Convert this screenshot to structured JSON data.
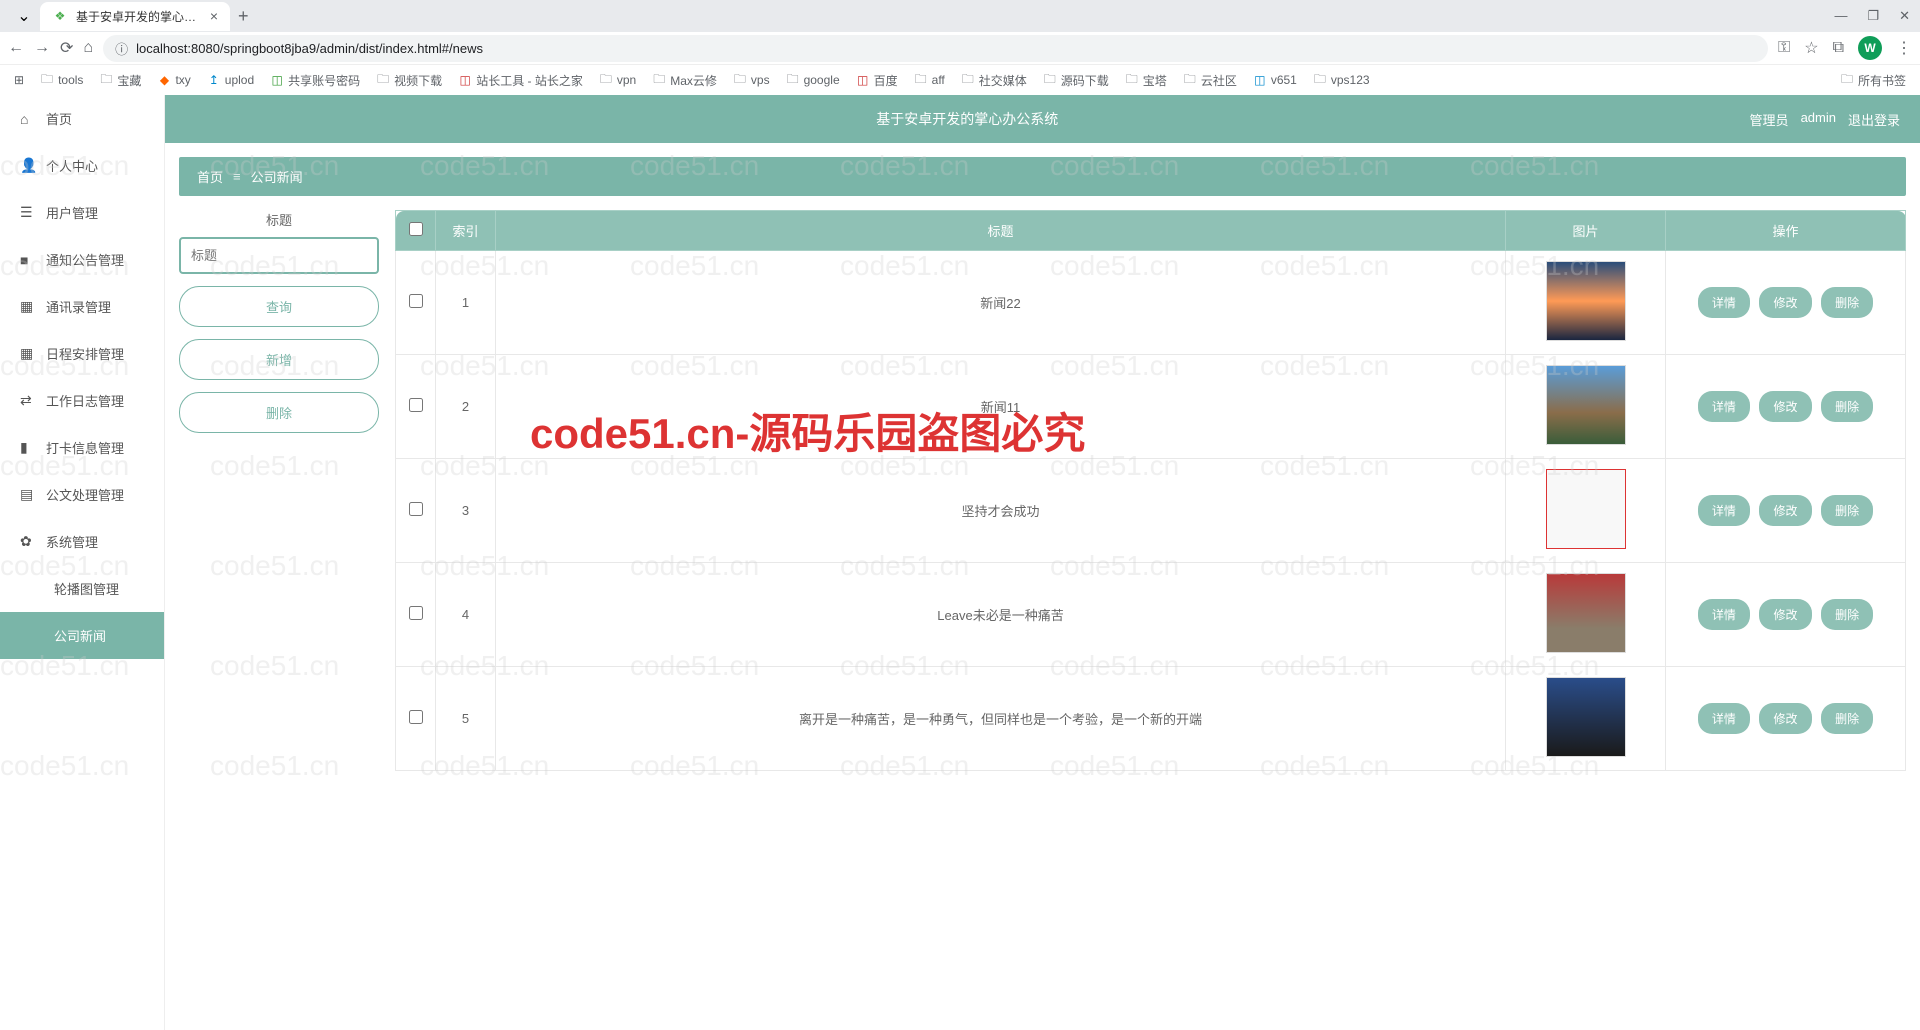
{
  "browser": {
    "tab_title": "基于安卓开发的掌心办公系统",
    "url": "localhost:8080/springboot8jba9/admin/dist/index.html#/news",
    "avatar_letter": "W",
    "bookmarks": [
      "tools",
      "宝藏",
      "txy",
      "uplod",
      "共享账号密码",
      "视频下载",
      "站长工具 - 站长之家",
      "vpn",
      "Max云修",
      "vps",
      "google",
      "百度",
      "aff",
      "社交媒体",
      "源码下载",
      "宝塔",
      "云社区",
      "v651",
      "vps123",
      "所有书签"
    ]
  },
  "header": {
    "title": "基于安卓开发的掌心办公系统",
    "role": "管理员",
    "user": "admin",
    "logout": "退出登录"
  },
  "sidebar": {
    "items": [
      {
        "icon": "⌂",
        "label": "首页"
      },
      {
        "icon": "👤",
        "label": "个人中心"
      },
      {
        "icon": "☰",
        "label": "用户管理"
      },
      {
        "icon": "■",
        "label": "通知公告管理"
      },
      {
        "icon": "▦",
        "label": "通讯录管理"
      },
      {
        "icon": "▦",
        "label": "日程安排管理"
      },
      {
        "icon": "⇄",
        "label": "工作日志管理"
      },
      {
        "icon": "▮",
        "label": "打卡信息管理"
      },
      {
        "icon": "▤",
        "label": "公文处理管理"
      },
      {
        "icon": "✿",
        "label": "系统管理"
      }
    ],
    "subs": [
      {
        "label": "轮播图管理"
      },
      {
        "label": "公司新闻"
      }
    ]
  },
  "breadcrumb": {
    "home": "首页",
    "sep": "≡",
    "current": "公司新闻"
  },
  "search": {
    "label": "标题",
    "placeholder": "标题",
    "query": "查询",
    "add": "新增",
    "delete": "删除"
  },
  "table": {
    "headers": {
      "index": "索引",
      "title": "标题",
      "image": "图片",
      "ops": "操作"
    },
    "btns": {
      "detail": "详情",
      "edit": "修改",
      "del": "删除"
    },
    "rows": [
      {
        "idx": "1",
        "title": "新闻22"
      },
      {
        "idx": "2",
        "title": "新闻11"
      },
      {
        "idx": "3",
        "title": "坚持才会成功"
      },
      {
        "idx": "4",
        "title": "Leave未必是一种痛苦"
      },
      {
        "idx": "5",
        "title": "离开是一种痛苦，是一种勇气，但同样也是一个考验，是一个新的开端"
      }
    ]
  },
  "watermark": "code51.cn",
  "big_watermark": "code51.cn-源码乐园盗图必究"
}
